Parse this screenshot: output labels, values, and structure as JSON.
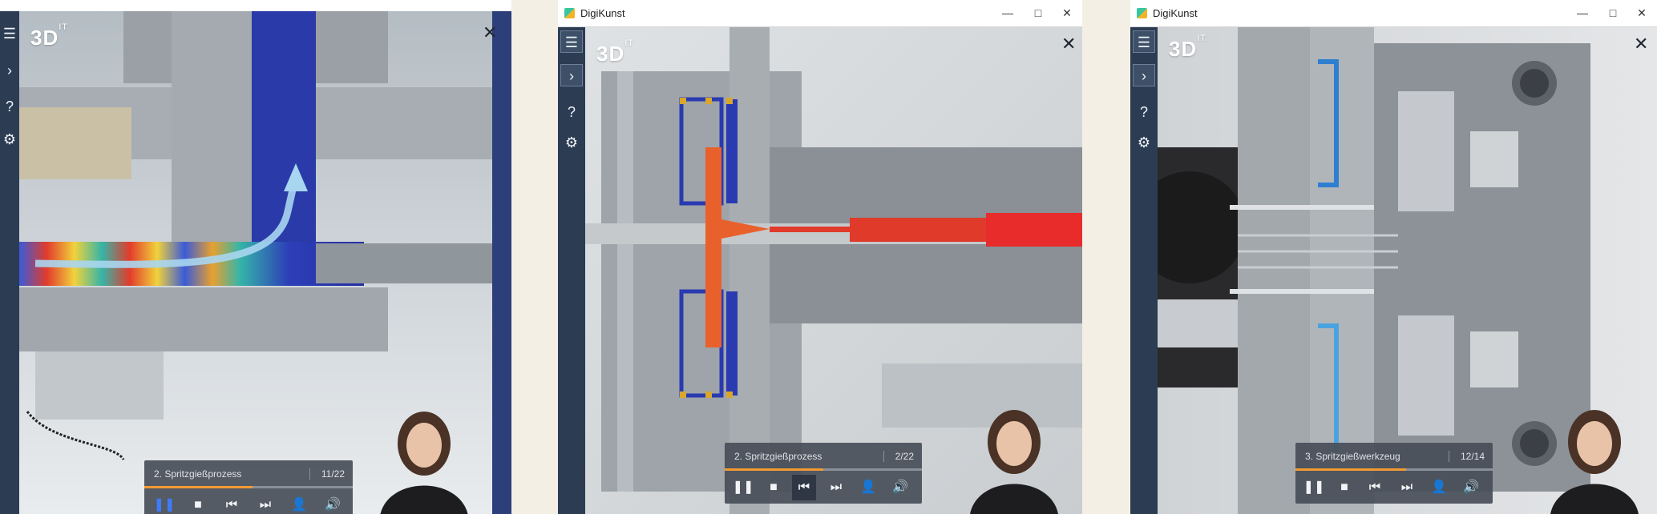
{
  "colors": {
    "sidebar": "#2c3c53",
    "accent": "#f29a33",
    "player": "#484e58",
    "background": "#f3efe4"
  },
  "windows": [
    {
      "title": "",
      "brand": "3D",
      "brand_sup": "IT",
      "sidebar": {
        "menu_icon": "☰",
        "expand_icon": "›",
        "help_label": "?",
        "settings_icon": "⚙"
      },
      "close_icon": "✕",
      "player": {
        "title": "2. Spritzgießprozess",
        "count": "11/22",
        "progress": 0.52,
        "controls": {
          "pause": "❚❚",
          "stop": "■",
          "prev": "⏮",
          "next": "⏭",
          "person": "👤",
          "volume": "🔊"
        }
      }
    },
    {
      "title": "DigiKunst",
      "window_controls": {
        "minimize": "—",
        "maximize": "□",
        "close": "✕"
      },
      "brand": "3D",
      "brand_sup": "IT",
      "sidebar": {
        "menu_icon": "☰",
        "expand_icon": "›",
        "help_label": "?",
        "settings_icon": "⚙"
      },
      "close_icon": "✕",
      "player": {
        "title": "2. Spritzgießprozess",
        "count": "2/22",
        "progress": 0.5,
        "controls": {
          "pause": "❚❚",
          "stop": "■",
          "prev": "⏮",
          "next": "⏭",
          "person": "👤",
          "volume": "🔊"
        }
      }
    },
    {
      "title": "DigiKunst",
      "window_controls": {
        "minimize": "—",
        "maximize": "□",
        "close": "✕"
      },
      "brand": "3D",
      "brand_sup": "IT",
      "sidebar": {
        "menu_icon": "☰",
        "expand_icon": "›",
        "help_label": "?",
        "settings_icon": "⚙"
      },
      "close_icon": "✕",
      "player": {
        "title": "3. Spritzgießwerkzeug",
        "count": "12/14",
        "progress": 0.56,
        "controls": {
          "pause": "❚❚",
          "stop": "■",
          "prev": "⏮",
          "next": "⏭",
          "person": "👤",
          "volume": "🔊"
        }
      }
    }
  ]
}
